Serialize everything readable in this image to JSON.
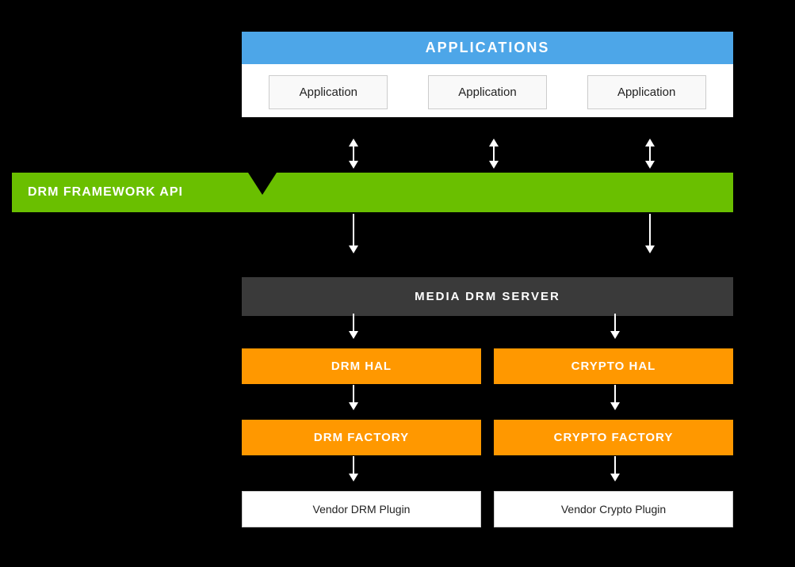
{
  "applications": {
    "header": "APPLICATIONS",
    "boxes": [
      "Application",
      "Application",
      "Application"
    ]
  },
  "drm_framework": {
    "label": "DRM FRAMEWORK API"
  },
  "media_drm_server": {
    "label": "MEDIA DRM SERVER"
  },
  "hal_row": {
    "left": "DRM HAL",
    "right": "CRYPTO HAL"
  },
  "factory_row": {
    "left": "DRM FACTORY",
    "right": "CRYPTO FACTORY"
  },
  "vendor_row": {
    "left": "Vendor DRM Plugin",
    "right": "Vendor Crypto Plugin"
  },
  "colors": {
    "applications_blue": "#4da6e8",
    "drm_green": "#6abf00",
    "media_dark": "#3a3a3a",
    "orange": "#ff9800",
    "white": "#ffffff",
    "black": "#000000"
  }
}
